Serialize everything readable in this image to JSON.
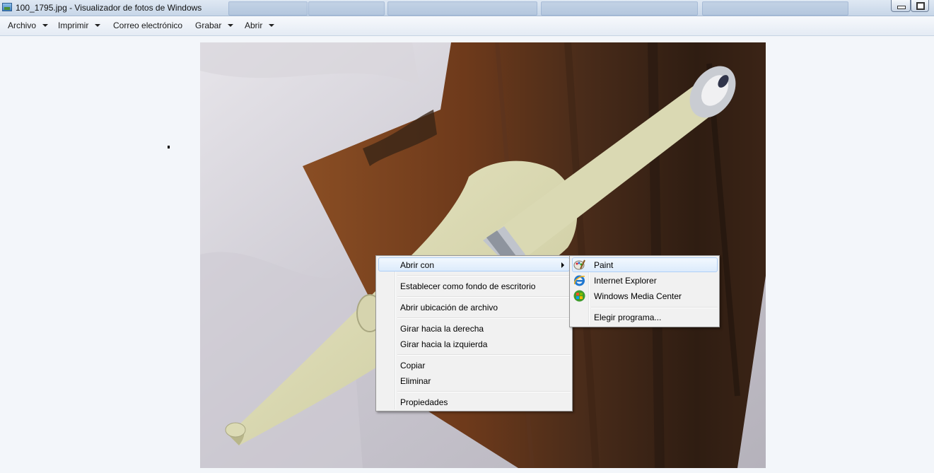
{
  "window": {
    "title": "100_1795.jpg - Visualizador de fotos de Windows"
  },
  "menubar": {
    "items": [
      {
        "label": "Archivo",
        "has_dropdown": true
      },
      {
        "label": "Imprimir",
        "has_dropdown": true
      },
      {
        "label": "Correo electrónico",
        "has_dropdown": false
      },
      {
        "label": "Grabar",
        "has_dropdown": true
      },
      {
        "label": "Abrir",
        "has_dropdown": true
      }
    ]
  },
  "photo": {
    "subject": "knife-with-sheath-on-wood"
  },
  "context_menu": {
    "items": [
      {
        "label": "Abrir con",
        "submenu": true,
        "highlighted": true
      },
      {
        "label": "Establecer como fondo de escritorio"
      },
      {
        "label": "Abrir ubicación de archivo"
      },
      {
        "label": "Girar hacia la derecha"
      },
      {
        "label": "Girar hacia la izquierda"
      },
      {
        "label": "Copiar"
      },
      {
        "label": "Eliminar"
      },
      {
        "label": "Propiedades"
      }
    ]
  },
  "submenu": {
    "items": [
      {
        "label": "Paint",
        "icon": "paint-icon",
        "highlighted": true
      },
      {
        "label": "Internet Explorer",
        "icon": "internet-explorer-icon"
      },
      {
        "label": "Windows Media Center",
        "icon": "windows-media-center-icon"
      },
      {
        "label": "Elegir programa..."
      }
    ]
  },
  "colors": {
    "menu_background": "#f1f1f1",
    "highlight_border": "#aecff7",
    "window_background": "#f3f6fa"
  }
}
